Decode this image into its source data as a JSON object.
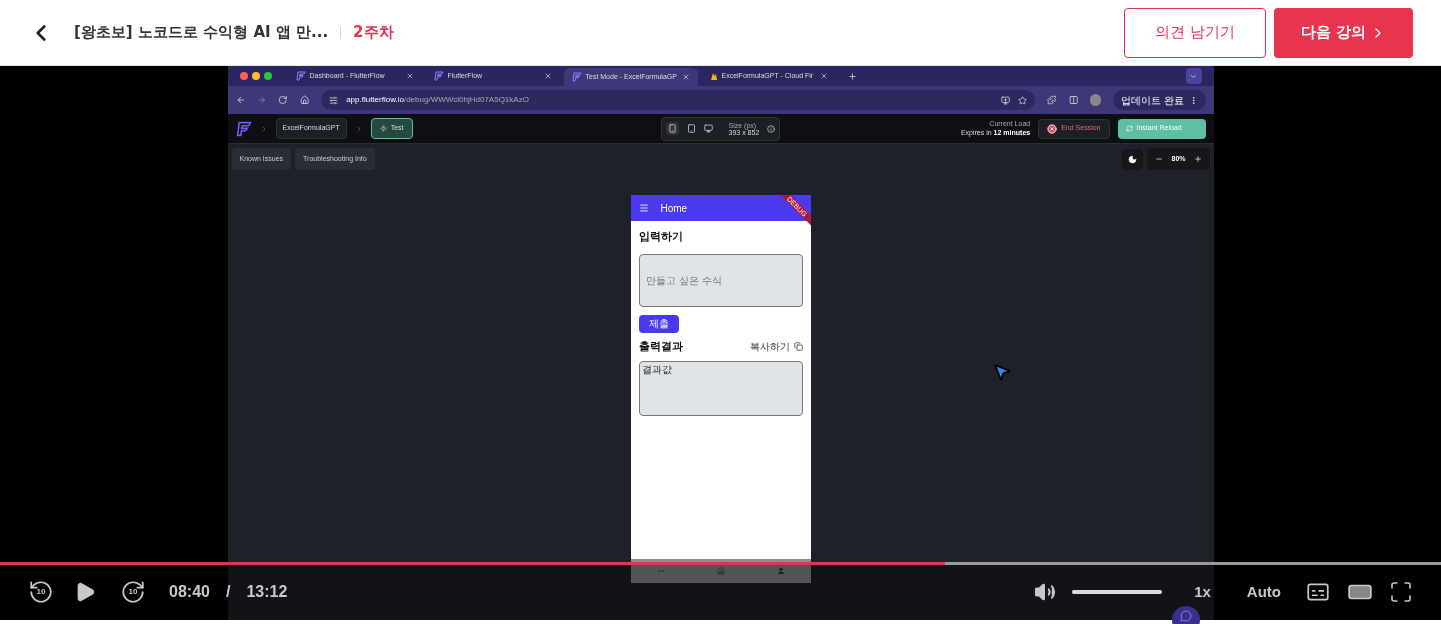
{
  "header": {
    "title": "[왕초보] 노코드로 수익형 AI 앱 만...",
    "week": "2주차",
    "feedback_button": "의견 남기기",
    "next_button": "다음 강의"
  },
  "video": {
    "browser": {
      "tabs": [
        {
          "label": "Dashboard - FlutterFlow",
          "selected": false,
          "kind": "flutterflow"
        },
        {
          "label": "FlutterFlow",
          "selected": false,
          "kind": "flutterflow"
        },
        {
          "label": "Test Mode - ExcelFormulaGP",
          "selected": true,
          "kind": "flutterflow"
        },
        {
          "label": "ExcelFormulaGPT - Cloud Fir",
          "selected": false,
          "kind": "firebase"
        }
      ],
      "url_host": "app.flutterflow.io",
      "url_path": "/debug/WWWcl0hjHd07A5Q1kAzO",
      "update_button": "업데이트 완료"
    },
    "toolbar": {
      "project": "ExcelFormulaGPT",
      "mode": "Test",
      "size_label": "Size (px)",
      "size_value": "393 x 852",
      "load_label": "Current Load",
      "expires_prefix": "Expires in",
      "expires_value": "12 minutes",
      "end_session": "End Session",
      "instant_reload": "Instant Reload"
    },
    "chips": [
      "Known Issues",
      "Troubleshooting Info"
    ],
    "zoom": "80%",
    "phone": {
      "app_title": "Home",
      "banner": "DEBUG",
      "input_heading": "입력하기",
      "input_placeholder": "만들고 싶은 수식",
      "submit": "제출",
      "output_heading": "출력결과",
      "copy": "복사하기",
      "output_value": "결과값"
    }
  },
  "player": {
    "progress": {
      "level": 0.656
    },
    "skip_back": "10",
    "skip_forward": "10",
    "current_time": "08:40",
    "separator": "/",
    "total_time": "13:12",
    "volume": {
      "level": 1
    },
    "speed": "1x",
    "quality": "Auto"
  }
}
